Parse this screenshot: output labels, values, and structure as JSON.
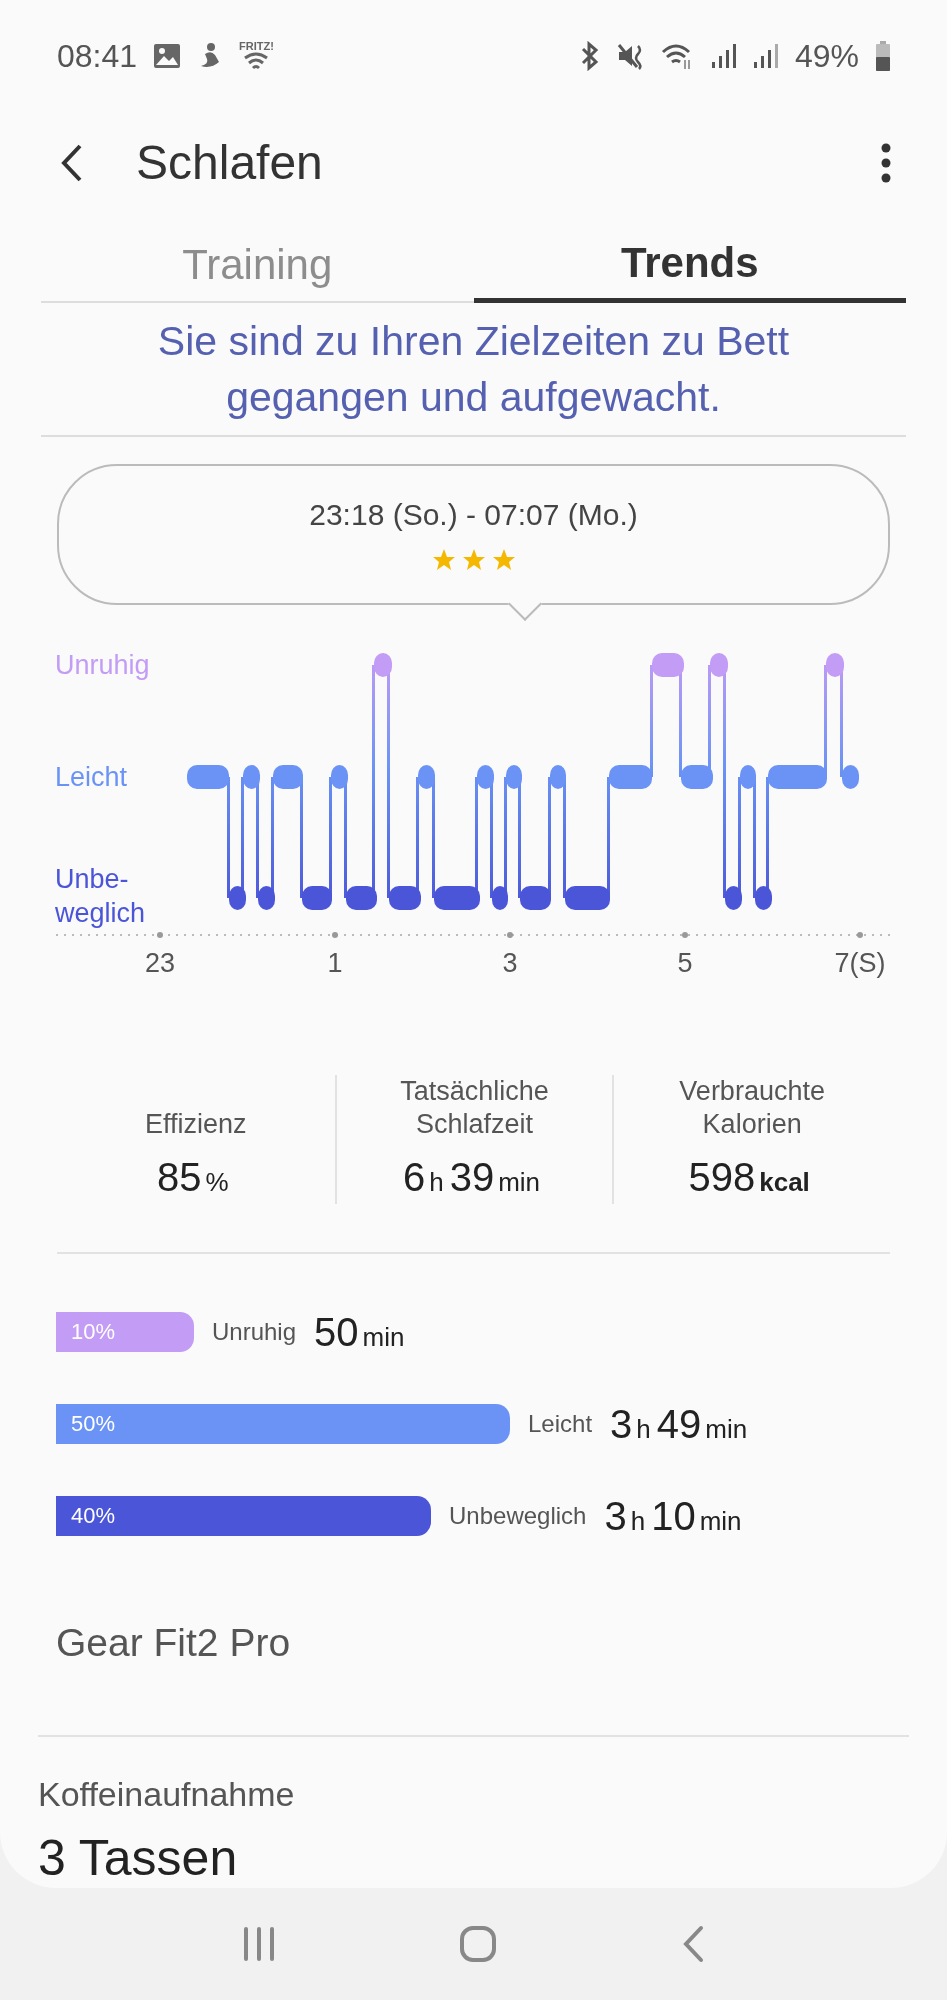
{
  "status_bar": {
    "time": "08:41",
    "wifi_label": "FRITZ!",
    "battery": "49%"
  },
  "header": {
    "title": "Schlafen"
  },
  "tabs": [
    {
      "label": "Training",
      "selected": false
    },
    {
      "label": "Trends",
      "selected": true
    }
  ],
  "message": "Sie sind zu Ihren Zielzeiten zu Bett gegangen und aufgewacht.",
  "session": {
    "time_range": "23:18 (So.) - 07:07 (Mo.)",
    "stars": 3
  },
  "hypnogram": {
    "levels": [
      {
        "label": "Unruhig",
        "color": "#c29cf5"
      },
      {
        "label": "Leicht",
        "color": "#6a93f5"
      },
      {
        "label": "Unbe-\nweglich",
        "color": "#4a55d8"
      }
    ],
    "x_labels": [
      "23",
      "1",
      "3",
      "5",
      "7(S)"
    ]
  },
  "stats": [
    {
      "label": "Effizienz",
      "value": [
        {
          "kind": "number",
          "text": "85"
        },
        {
          "kind": "unit",
          "text": "%"
        }
      ]
    },
    {
      "label": "Tatsächliche\nSchlafzeit",
      "value": [
        {
          "kind": "number",
          "text": "6"
        },
        {
          "kind": "unit",
          "text": "h"
        },
        {
          "kind": "number",
          "text": "39"
        },
        {
          "kind": "unit",
          "text": "min"
        }
      ]
    },
    {
      "label": "Verbrauchte\nKalorien",
      "value": [
        {
          "kind": "number",
          "text": "598"
        },
        {
          "kind": "unit_bold",
          "text": "kcal"
        }
      ]
    }
  ],
  "stages": [
    {
      "percent": "10%",
      "color": "#c29cf5",
      "label": "Unruhig",
      "duration": [
        {
          "kind": "number",
          "text": "50"
        },
        {
          "kind": "unit",
          "text": "min"
        }
      ]
    },
    {
      "percent": "50%",
      "color": "#6a93f5",
      "label": "Leicht",
      "duration": [
        {
          "kind": "number",
          "text": "3"
        },
        {
          "kind": "unit",
          "text": "h"
        },
        {
          "kind": "number",
          "text": "49"
        },
        {
          "kind": "unit",
          "text": "min"
        }
      ]
    },
    {
      "percent": "40%",
      "color": "#4a55d8",
      "label": "Unbeweglich",
      "duration": [
        {
          "kind": "number",
          "text": "3"
        },
        {
          "kind": "unit",
          "text": "h"
        },
        {
          "kind": "number",
          "text": "10"
        },
        {
          "kind": "unit",
          "text": "min"
        }
      ]
    }
  ],
  "device": "Gear Fit2 Pro",
  "caffeine": {
    "label": "Koffeinaufnahme",
    "value": "3 Tassen"
  }
}
